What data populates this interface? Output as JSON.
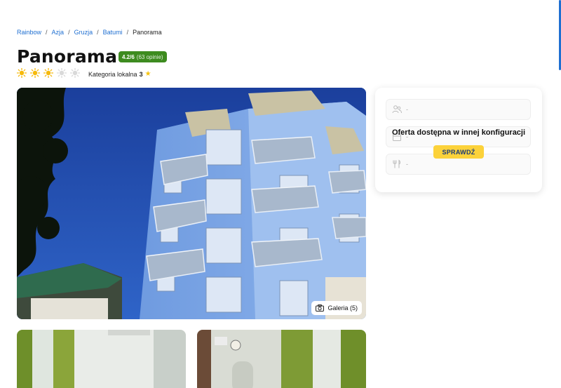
{
  "breadcrumb": {
    "items": [
      "Rainbow",
      "Azja",
      "Gruzja",
      "Batumi"
    ],
    "current": "Panorama",
    "separator": "/"
  },
  "hotel": {
    "name": "Panorama",
    "rating_score": "4.2/6",
    "rating_count": "(63 opinie)",
    "sun_rating": 3,
    "sun_rating_max": 5,
    "category_label": "Kategoria lokalna",
    "category_value": "3"
  },
  "gallery": {
    "button_label": "Galeria (5)"
  },
  "offer_card": {
    "field_placeholder": "-",
    "message": "Oferta dostępna w innej konfiguracji",
    "button_label": "SPRAWDŹ"
  },
  "colors": {
    "link": "#1f6fd1",
    "rating_badge": "#3d8b1f",
    "cta": "#fcd23a",
    "cta_text": "#1a3a78",
    "sun_active": "#f6b90b",
    "sun_inactive": "#d9d9d9"
  },
  "icons": {
    "sun": "sun-icon",
    "star": "star-icon",
    "camera": "camera-icon",
    "travelers": "people-icon",
    "calendar": "calendar-icon",
    "meal": "cutlery-icon"
  }
}
